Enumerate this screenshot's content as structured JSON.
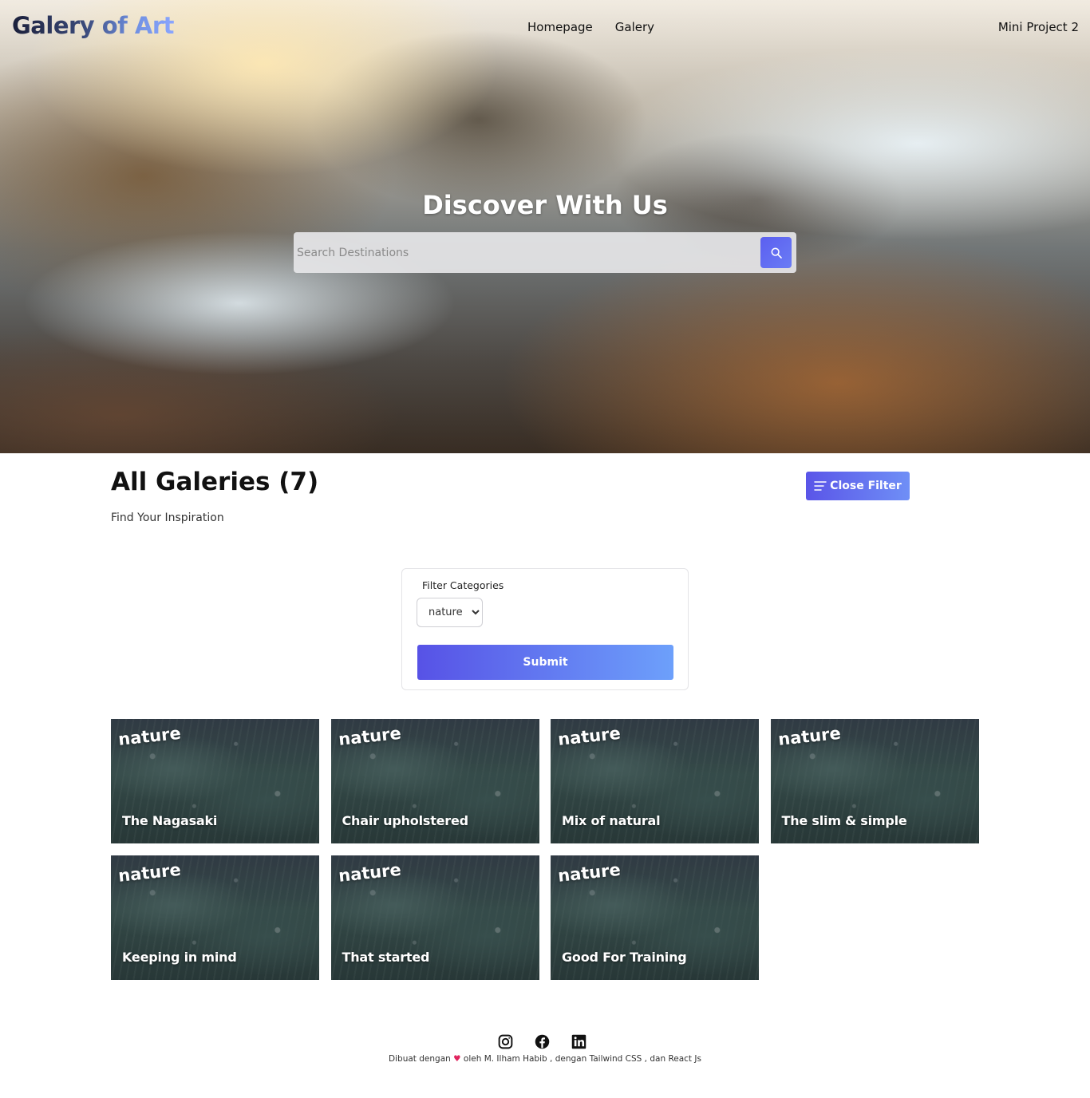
{
  "nav": {
    "logo": "Galery of Art",
    "links": [
      "Homepage",
      "Galery"
    ],
    "right_label": "Mini Project 2"
  },
  "hero": {
    "title": "Discover With Us",
    "search_placeholder": "Search Destinations",
    "search_icon": "search-icon"
  },
  "section": {
    "title": "All Galeries (7)",
    "subtitle": "Find Your Inspiration",
    "toggle_label": "Close Filter",
    "toggle_icon": "filter-lines-icon"
  },
  "filter": {
    "label": "Filter Categories",
    "selected": "nature",
    "submit_label": "Submit"
  },
  "gallery": [
    {
      "tag": "nature",
      "title": "The Nagasaki"
    },
    {
      "tag": "nature",
      "title": "Chair upholstered"
    },
    {
      "tag": "nature",
      "title": "Mix of natural"
    },
    {
      "tag": "nature",
      "title": "The slim & simple"
    },
    {
      "tag": "nature",
      "title": "Keeping in mind"
    },
    {
      "tag": "nature",
      "title": "That started"
    },
    {
      "tag": "nature",
      "title": "Good For Training"
    }
  ],
  "footer": {
    "icons": [
      "instagram-icon",
      "facebook-icon",
      "linkedin-icon"
    ],
    "text_before": "Dibuat dengan",
    "heart": "♥",
    "text_after": "oleh M. Ilham Habib , dengan Tailwind CSS , dan React Js"
  },
  "colors": {
    "accent_start": "#5a55e8",
    "accent_end": "#6f8ff6",
    "heart": "#e0245e"
  }
}
